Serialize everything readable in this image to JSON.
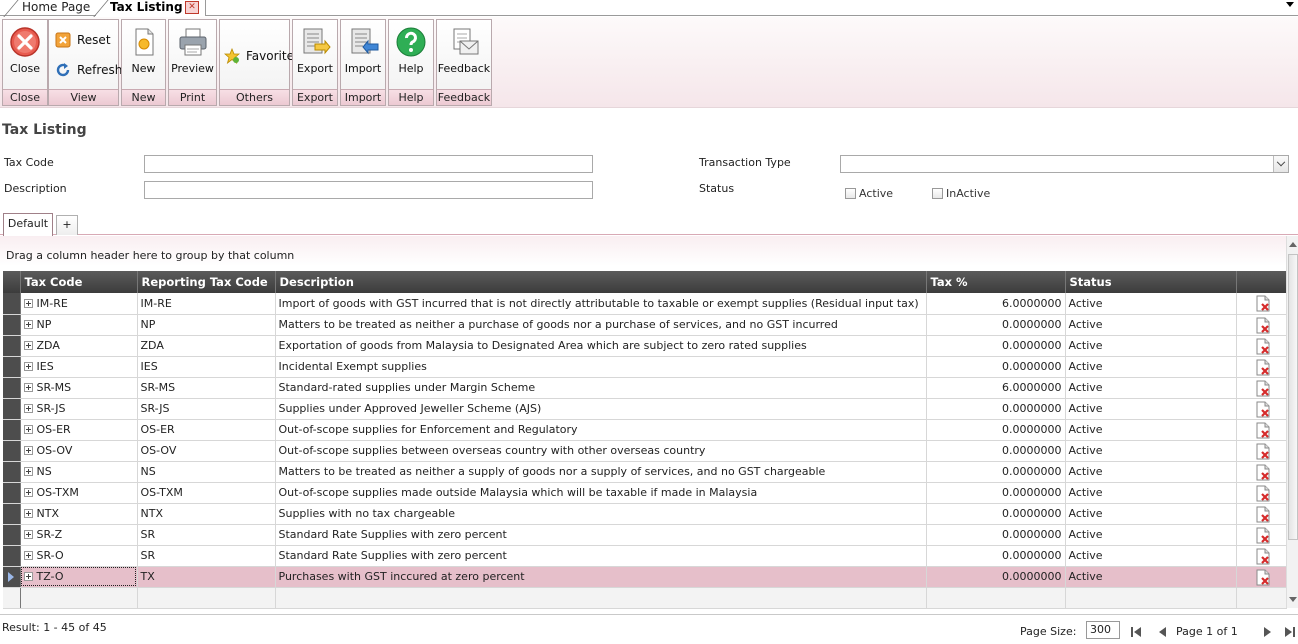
{
  "tabs": [
    {
      "label": "Home Page"
    },
    {
      "label": "Tax Listing"
    }
  ],
  "ribbon": {
    "close": {
      "label": "Close",
      "group": "Close"
    },
    "view": {
      "reset": "Reset",
      "refresh": "Refresh",
      "group": "View"
    },
    "new": {
      "label": "New",
      "group": "New"
    },
    "print": {
      "label": "Preview",
      "group": "Print"
    },
    "others": {
      "label": "Favorite",
      "group": "Others"
    },
    "export": {
      "label": "Export",
      "group": "Export"
    },
    "import": {
      "label": "Import",
      "group": "Import"
    },
    "help": {
      "label": "Help",
      "group": "Help"
    },
    "feedback": {
      "label": "Feedback",
      "group": "Feedback"
    }
  },
  "page": {
    "title": "Tax Listing"
  },
  "filters": {
    "tax_code": {
      "label": "Tax Code",
      "value": ""
    },
    "description": {
      "label": "Description",
      "value": ""
    },
    "transaction_type": {
      "label": "Transaction Type",
      "value": ""
    },
    "status": {
      "label": "Status",
      "active": "Active",
      "inactive": "InActive"
    }
  },
  "view_tabs": {
    "default": "Default",
    "add": "+"
  },
  "grid": {
    "group_hint": "Drag a column header here to group by that column",
    "columns": {
      "tax_code": "Tax Code",
      "reporting": "Reporting Tax Code",
      "description": "Description",
      "tax_pct": "Tax %",
      "status": "Status"
    },
    "rows": [
      {
        "code": "IM-RE",
        "reporting": "IM-RE",
        "description": "Import of goods with GST incurred that is not directly attributable to taxable or exempt supplies (Residual input tax)",
        "tax": "6.0000000",
        "status": "Active"
      },
      {
        "code": "NP",
        "reporting": "NP",
        "description": "Matters to be treated as neither a purchase of goods nor a purchase of services, and no GST incurred",
        "tax": "0.0000000",
        "status": "Active"
      },
      {
        "code": "ZDA",
        "reporting": "ZDA",
        "description": "Exportation of goods from Malaysia to Designated Area which are subject to zero rated supplies",
        "tax": "0.0000000",
        "status": "Active"
      },
      {
        "code": "IES",
        "reporting": "IES",
        "description": "Incidental Exempt supplies",
        "tax": "0.0000000",
        "status": "Active"
      },
      {
        "code": "SR-MS",
        "reporting": "SR-MS",
        "description": "Standard-rated supplies under Margin Scheme",
        "tax": "6.0000000",
        "status": "Active"
      },
      {
        "code": "SR-JS",
        "reporting": "SR-JS",
        "description": "Supplies under Approved Jeweller Scheme (AJS)",
        "tax": "0.0000000",
        "status": "Active"
      },
      {
        "code": "OS-ER",
        "reporting": "OS-ER",
        "description": "Out-of-scope supplies for Enforcement and Regulatory",
        "tax": "0.0000000",
        "status": "Active"
      },
      {
        "code": "OS-OV",
        "reporting": "OS-OV",
        "description": "Out-of-scope supplies between overseas country with other overseas country",
        "tax": "0.0000000",
        "status": "Active"
      },
      {
        "code": "NS",
        "reporting": "NS",
        "description": "Matters to be treated as neither a supply of goods nor a supply of services, and no GST chargeable",
        "tax": "0.0000000",
        "status": "Active"
      },
      {
        "code": "OS-TXM",
        "reporting": "OS-TXM",
        "description": "Out-of-scope supplies made outside Malaysia which will be taxable if made in Malaysia",
        "tax": "0.0000000",
        "status": "Active"
      },
      {
        "code": "NTX",
        "reporting": "NTX",
        "description": "Supplies with no tax chargeable",
        "tax": "0.0000000",
        "status": "Active"
      },
      {
        "code": "SR-Z",
        "reporting": "SR",
        "description": "Standard Rate Supplies with zero percent",
        "tax": "0.0000000",
        "status": "Active"
      },
      {
        "code": "SR-O",
        "reporting": "SR",
        "description": "Standard Rate Supplies with zero percent",
        "tax": "0.0000000",
        "status": "Active"
      },
      {
        "code": "TZ-O",
        "reporting": "TX",
        "description": "Purchases with GST inccured at zero percent",
        "tax": "0.0000000",
        "status": "Active"
      }
    ]
  },
  "footer": {
    "result": "Result: 1 - 45 of 45",
    "page_size_label": "Page Size:",
    "page_size": "300",
    "page_label": "Page 1 of 1"
  }
}
